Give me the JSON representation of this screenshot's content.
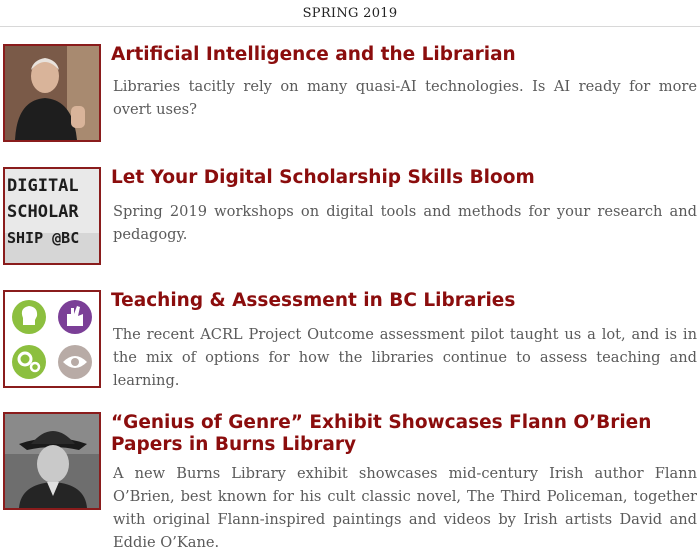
{
  "header": {
    "label": "SPRING 2019"
  },
  "articles": [
    {
      "title": "Artificial Intelligence and the Librarian",
      "desc": "Libraries tacitly rely on many quasi-AI technologies. Is AI ready for more overt uses?"
    },
    {
      "title": "Let Your Digital Scholarship Skills Bloom",
      "desc": "Spring 2019 workshops on digital tools and methods for your research and pedagogy.",
      "thumb_text": [
        "DIGITAL",
        "SCHOLAR",
        "SHIP @BC"
      ]
    },
    {
      "title": "Teaching & Assessment in BC Libraries",
      "desc": "The recent ACRL Project Outcome assessment pilot taught us a lot, and is in the mix of options for how the libraries continue to assess teaching and learning."
    },
    {
      "title": "“Genius of Genre” Exhibit Showcases Flann O’Brien Papers in Burns Library",
      "desc": "A new Burns Library exhibit showcases mid-century Irish author Flann O’Brien, best known for his cult classic novel, The Third Policeman, together with original Flann-inspired paintings and videos by Irish artists David and Eddie O’Kane."
    }
  ],
  "colors": {
    "title": "#8b0d0d",
    "thumb_border": "#8a1c1c",
    "green": "#8cbf3f",
    "purple": "#7b3f97",
    "gray": "#b8aba6"
  }
}
